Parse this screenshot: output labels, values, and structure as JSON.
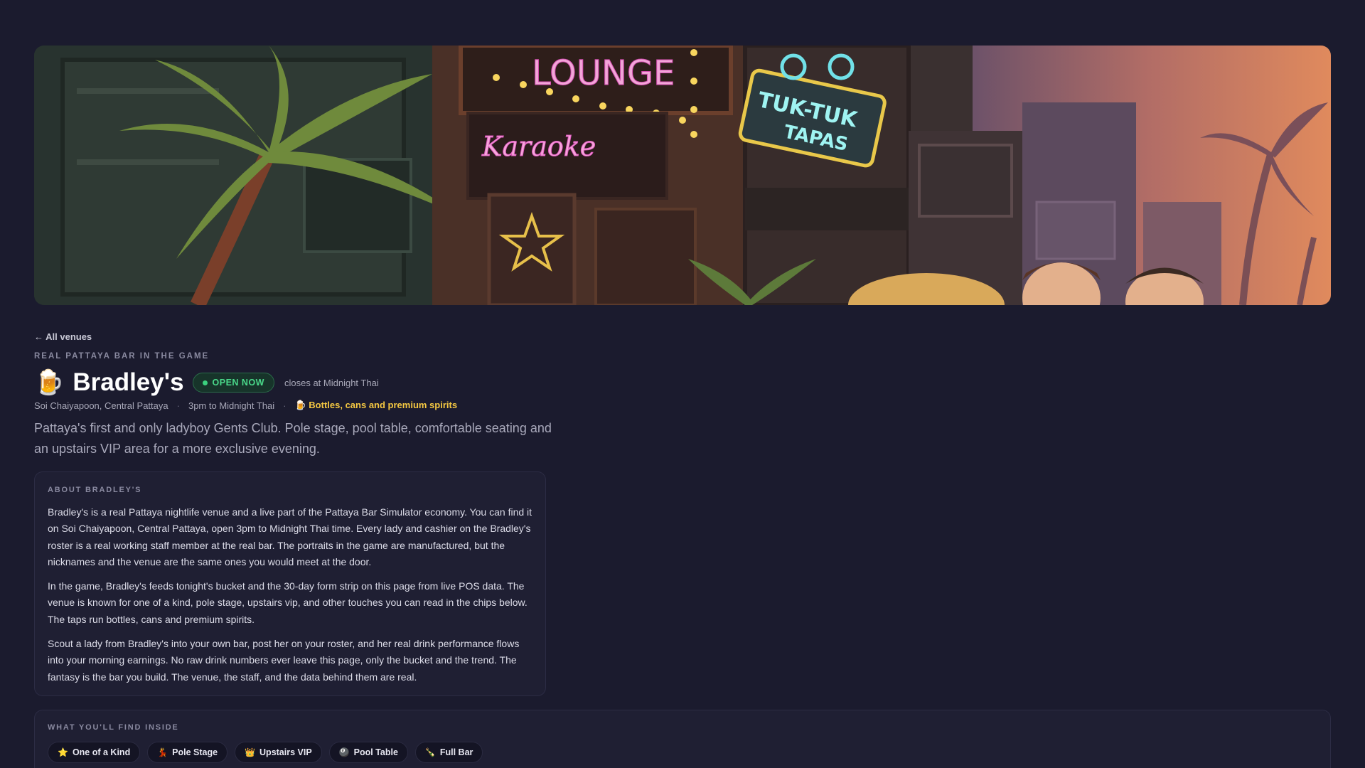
{
  "hero": {
    "signs": [
      "LOUNGE",
      "Karaoke",
      "TUK-TUK TAPAS"
    ]
  },
  "nav": {
    "back_label": "← All venues"
  },
  "venue": {
    "eyebrow": "REAL PATTAYA BAR IN THE GAME",
    "emoji": "🍺",
    "name": "Bradley's",
    "status": "OPEN NOW",
    "closes": "closes at Midnight Thai",
    "location": "Soi Chaiyapoon, Central Pattaya",
    "hours": "3pm to Midnight Thai",
    "drinks_icon": "🍺",
    "drinks": "Bottles, cans and premium spirits",
    "separator": "·",
    "intro": "Pattaya's first and only ladyboy Gents Club. Pole stage, pool table, comfortable seating and an upstairs VIP area for a more exclusive evening."
  },
  "about": {
    "heading": "ABOUT BRADLEY'S",
    "paragraphs": [
      "Bradley's is a real Pattaya nightlife venue and a live part of the Pattaya Bar Simulator economy. You can find it on Soi Chaiyapoon, Central Pattaya, open 3pm to Midnight Thai time. Every lady and cashier on the Bradley's roster is a real working staff member at the real bar. The portraits in the game are manufactured, but the nicknames and the venue are the same ones you would meet at the door.",
      "In the game, Bradley's feeds tonight's bucket and the 30-day form strip on this page from live POS data. The venue is known for one of a kind, pole stage, upstairs vip, and other touches you can read in the chips below. The taps run bottles, cans and premium spirits.",
      "Scout a lady from Bradley's into your own bar, post her on your roster, and her real drink performance flows into your morning earnings. No raw drink numbers ever leave this page, only the bucket and the trend. The fantasy is the bar you build. The venue, the staff, and the data behind them are real."
    ]
  },
  "features": {
    "heading": "WHAT YOU'LL FIND INSIDE",
    "chips": [
      {
        "icon": "⭐",
        "label": "One of a Kind"
      },
      {
        "icon": "💃",
        "label": "Pole Stage"
      },
      {
        "icon": "👑",
        "label": "Upstairs VIP"
      },
      {
        "icon": "🎱",
        "label": "Pool Table"
      },
      {
        "icon": "🍾",
        "label": "Full Bar"
      }
    ]
  },
  "colors": {
    "background": "#1b1b2e",
    "open_green": "#4ad98a",
    "drinks_yellow": "#f5c842"
  }
}
